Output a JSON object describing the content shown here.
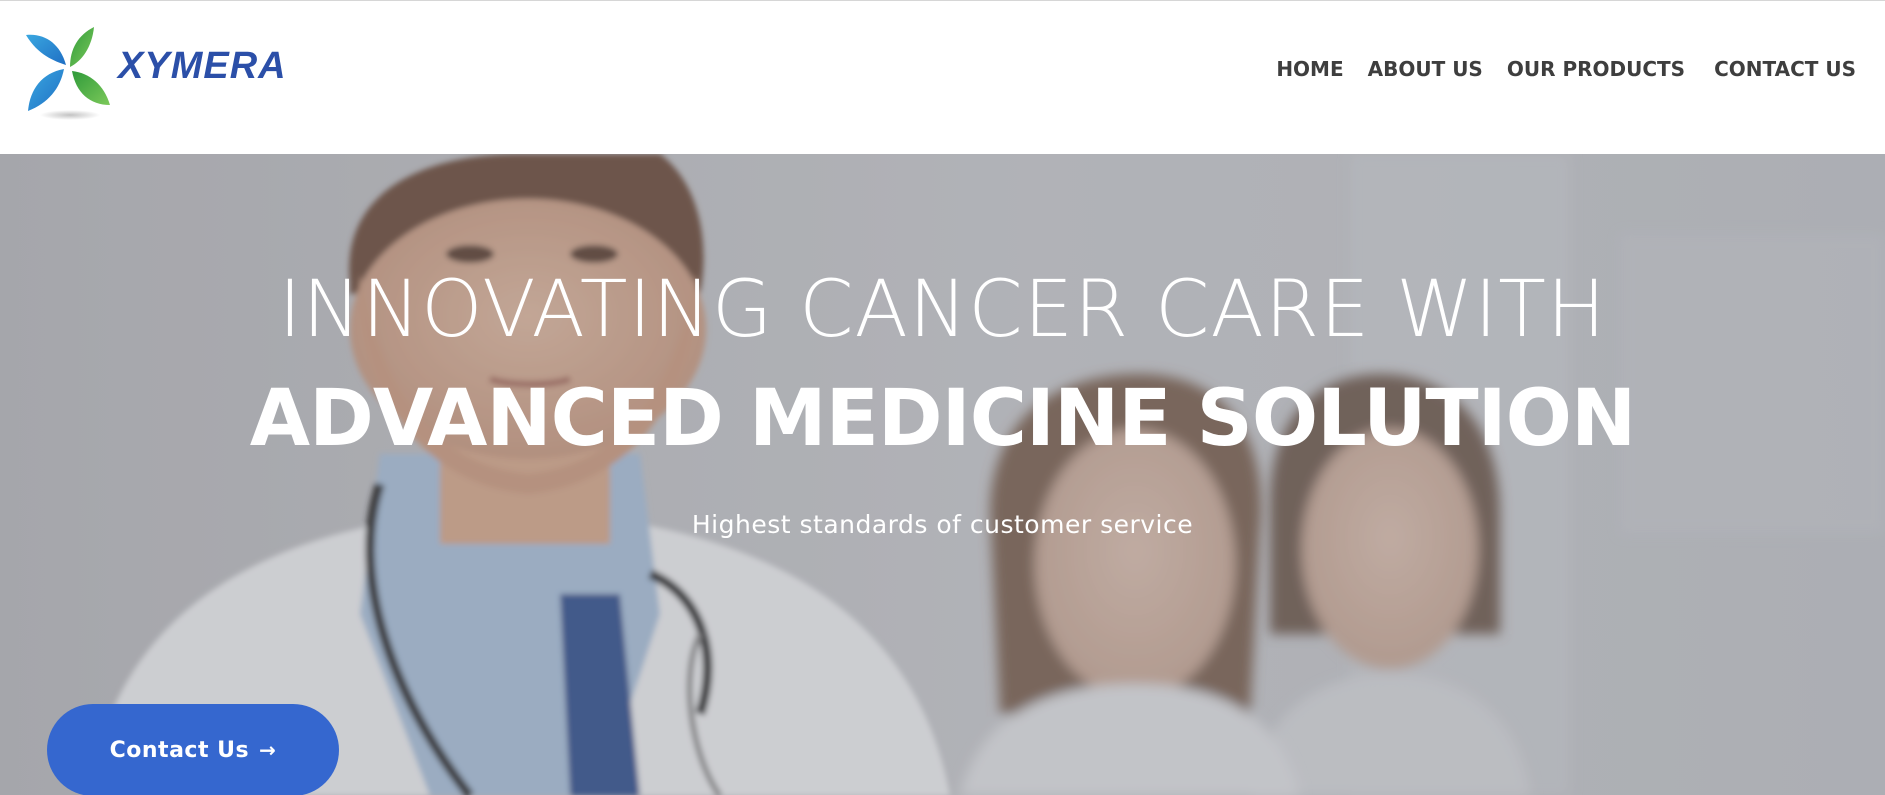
{
  "brand": {
    "name": "XYMERA",
    "colors": {
      "logo_blue": "#2b4fa8",
      "logo_green": "#55b848",
      "cta_blue": "#3567cf"
    }
  },
  "nav": {
    "items": [
      {
        "label": "HOME"
      },
      {
        "label": "ABOUT US"
      },
      {
        "label": "OUR PRODUCTS"
      },
      {
        "label": "CONTACT US"
      }
    ]
  },
  "hero": {
    "heading_line1": "INNOVATING CANCER CARE WITH",
    "heading_line2": "ADVANCED MEDICINE SOLUTION",
    "subheading": "Highest standards of customer service",
    "cta_label": "Contact Us",
    "cta_icon": "arrow-right-icon",
    "cta_glyph": "→",
    "background_image": "doctor-and-nurses-photo"
  }
}
